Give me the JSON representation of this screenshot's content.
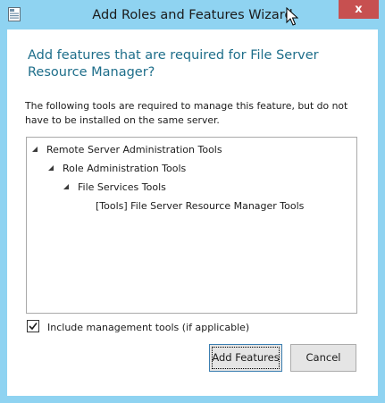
{
  "window": {
    "title": "Add Roles and Features Wizard",
    "close_label": "x"
  },
  "dialog": {
    "heading": "Add features that are required for File Server Resource Manager?",
    "description": "The following tools are required to manage this feature, but do not have to be installed on the same server."
  },
  "tree": {
    "items": [
      {
        "label": "Remote Server Administration Tools",
        "expanded": true,
        "level": 0
      },
      {
        "label": "Role Administration Tools",
        "expanded": true,
        "level": 1
      },
      {
        "label": "File Services Tools",
        "expanded": true,
        "level": 2
      },
      {
        "label": "[Tools] File Server Resource Manager Tools",
        "expanded": false,
        "level": 3
      }
    ]
  },
  "options": {
    "include_tools_label": "Include management tools (if applicable)",
    "include_tools_checked": true
  },
  "buttons": {
    "add_features": "Add Features",
    "cancel": "Cancel"
  },
  "colors": {
    "frame": "#8fd3f1",
    "close": "#c75050",
    "heading": "#1e6e8a"
  }
}
